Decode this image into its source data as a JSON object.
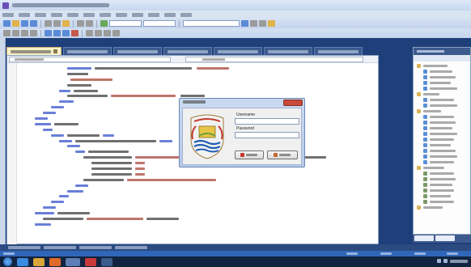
{
  "ide": {
    "title": ""
  },
  "login_dialog": {
    "title": "",
    "username_label": "Username",
    "password_label": "Password",
    "username_value": "",
    "password_value": "",
    "login_button": "",
    "cancel_button": ""
  },
  "colors": {
    "title_bar": "#dfe9f7",
    "ide_background": "#1e3f7a",
    "active_tab": "#fbf1c7",
    "status_bar": "#2f66b8",
    "taskbar": "#11243f",
    "dialog_frame": "#c9daf1"
  },
  "icons": {
    "app": "visual-studio-icon",
    "dialog_logo": "crest-logo-icon",
    "taskbar": [
      "start-orb-icon",
      "internet-explorer-icon",
      "folder-icon",
      "media-player-icon",
      "visual-studio-icon",
      "app-icon"
    ]
  }
}
